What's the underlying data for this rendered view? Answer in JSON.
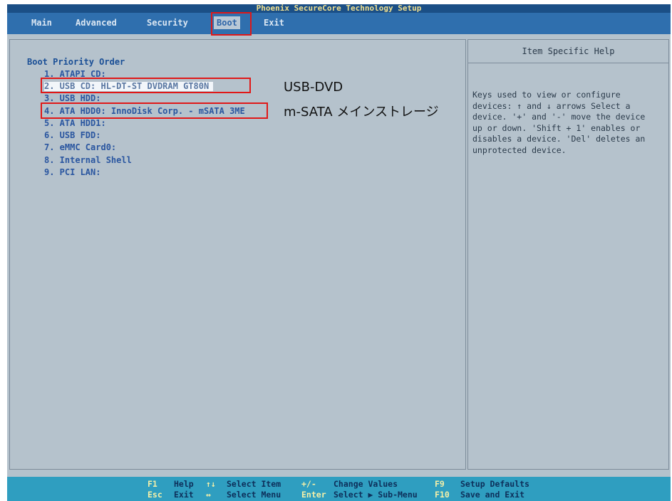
{
  "window": {
    "title": "Phoenix SecureCore Technology Setup"
  },
  "menu": {
    "items": [
      {
        "label": "Main"
      },
      {
        "label": "Advanced"
      },
      {
        "label": "Security"
      },
      {
        "label": "Boot"
      },
      {
        "label": "Exit"
      }
    ],
    "active": "Boot"
  },
  "boot": {
    "section_title": "Boot Priority Order",
    "items": [
      "1.  ATAPI CD:",
      "2.  USB CD: HL-DT-ST DVDRAM GT80N",
      "3.  USB HDD:",
      "4.  ATA HDD0: InnoDisk Corp. - mSATA 3ME",
      "5.  ATA HDD1:",
      "6.  USB FDD:",
      "7.  eMMC Card0:",
      "8.  Internal Shell",
      "9.  PCI LAN:"
    ],
    "selected_index": 1
  },
  "help": {
    "title": "Item Specific Help",
    "text": "Keys used to view or configure\ndevices: ↑ and ↓ arrows Select a\ndevice. '+' and '-' move the device\nup or down. 'Shift + 1' enables or\ndisables a device. 'Del' deletes an\nunprotected device."
  },
  "annotations": {
    "usb_dvd": "USB-DVD",
    "msata": "m-SATA メインストレージ"
  },
  "footer": {
    "row1": [
      {
        "key": "F1",
        "desc": "Help"
      },
      {
        "key": "↑↓",
        "desc": "Select Item"
      },
      {
        "key": "+/-",
        "desc": "Change Values"
      },
      {
        "key": "F9",
        "desc": "Setup Defaults"
      }
    ],
    "row2": [
      {
        "key": "Esc",
        "desc": "Exit"
      },
      {
        "key": "↔",
        "desc": "Select Menu"
      },
      {
        "key": "Enter",
        "desc": "Select ▶ Sub-Menu"
      },
      {
        "key": "F10",
        "desc": "Save and Exit"
      }
    ]
  },
  "colors": {
    "callout": "#e01818",
    "menubar": "#2f6fae",
    "footer": "#2f9ec0",
    "panel": "#b5c2cc"
  }
}
